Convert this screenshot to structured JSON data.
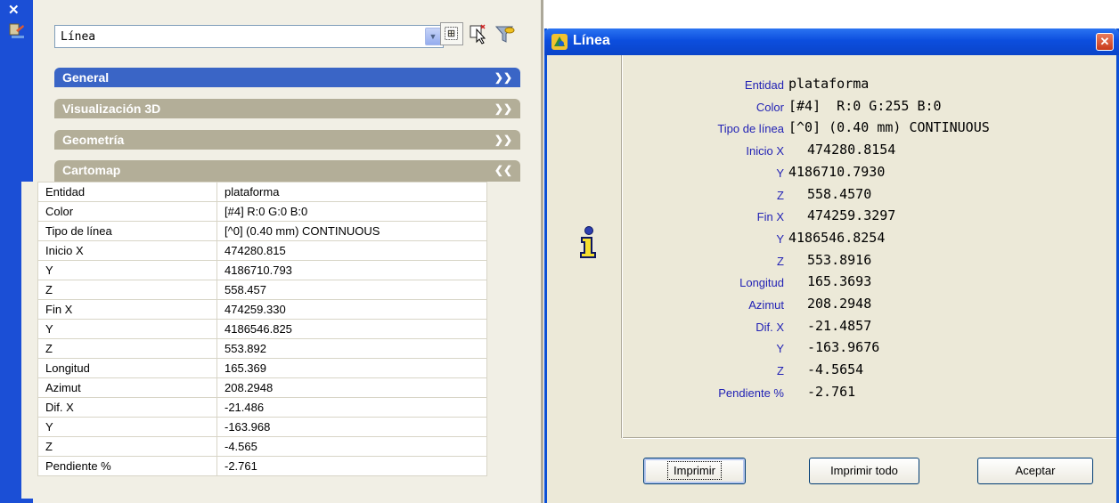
{
  "palette": {
    "selector_value": "Línea",
    "sections": {
      "general": "General",
      "vis3d": "Visualización 3D",
      "geometria": "Geometría",
      "cartomap": "Cartomap"
    },
    "rows": [
      {
        "key": "Entidad",
        "value": "plataforma"
      },
      {
        "key": "Color",
        "value": "[#4]  R:0 G:0 B:0"
      },
      {
        "key": "Tipo de línea",
        "value": "[^0] (0.40 mm) CONTINUOUS"
      },
      {
        "key": "Inicio X",
        "value": "474280.815"
      },
      {
        "key": "Y",
        "value": "4186710.793"
      },
      {
        "key": "Z",
        "value": "558.457"
      },
      {
        "key": "Fin X",
        "value": "474259.330"
      },
      {
        "key": "Y",
        "value": "4186546.825"
      },
      {
        "key": "Z",
        "value": "553.892"
      },
      {
        "key": "Longitud",
        "value": "165.369"
      },
      {
        "key": "Azimut",
        "value": "208.2948"
      },
      {
        "key": "Dif. X",
        "value": "-21.486"
      },
      {
        "key": "Y",
        "value": "-163.968"
      },
      {
        "key": "Z",
        "value": "-4.565"
      },
      {
        "key": "Pendiente %",
        "value": "-2.761"
      }
    ]
  },
  "dialog": {
    "title": "Línea",
    "close_glyph": "✕",
    "rows": [
      {
        "label": "Entidad",
        "value": "plataforma"
      },
      {
        "label": "Color",
        "value": "[#4]  R:0 G:255 B:0"
      },
      {
        "label": "Tipo de línea",
        "value": "[^0] (0.40 mm) CONTINUOUS"
      },
      {
        "label": "Inicio X",
        "value": "474280.8154"
      },
      {
        "label": "Y",
        "value": "4186710.7930"
      },
      {
        "label": "Z",
        "value": "558.4570"
      },
      {
        "label": "Fin X",
        "value": "474259.3297"
      },
      {
        "label": "Y",
        "value": "4186546.8254"
      },
      {
        "label": "Z",
        "value": "553.8916"
      },
      {
        "label": "Longitud",
        "value": "165.3693"
      },
      {
        "label": "Azimut",
        "value": "208.2948"
      },
      {
        "label": "Dif. X",
        "value": "-21.4857"
      },
      {
        "label": "Y",
        "value": "-163.9676"
      },
      {
        "label": "Z",
        "value": "-4.5654"
      },
      {
        "label": "Pendiente %",
        "value": "-2.761"
      }
    ],
    "buttons": {
      "print": "Imprimir",
      "print_all": "Imprimir todo",
      "accept": "Aceptar"
    }
  },
  "colors": {
    "title_blue": "#0c4ede",
    "section_active": "#3a65c6",
    "section_inactive": "#b3ae98",
    "label_blue": "#2222b5"
  }
}
